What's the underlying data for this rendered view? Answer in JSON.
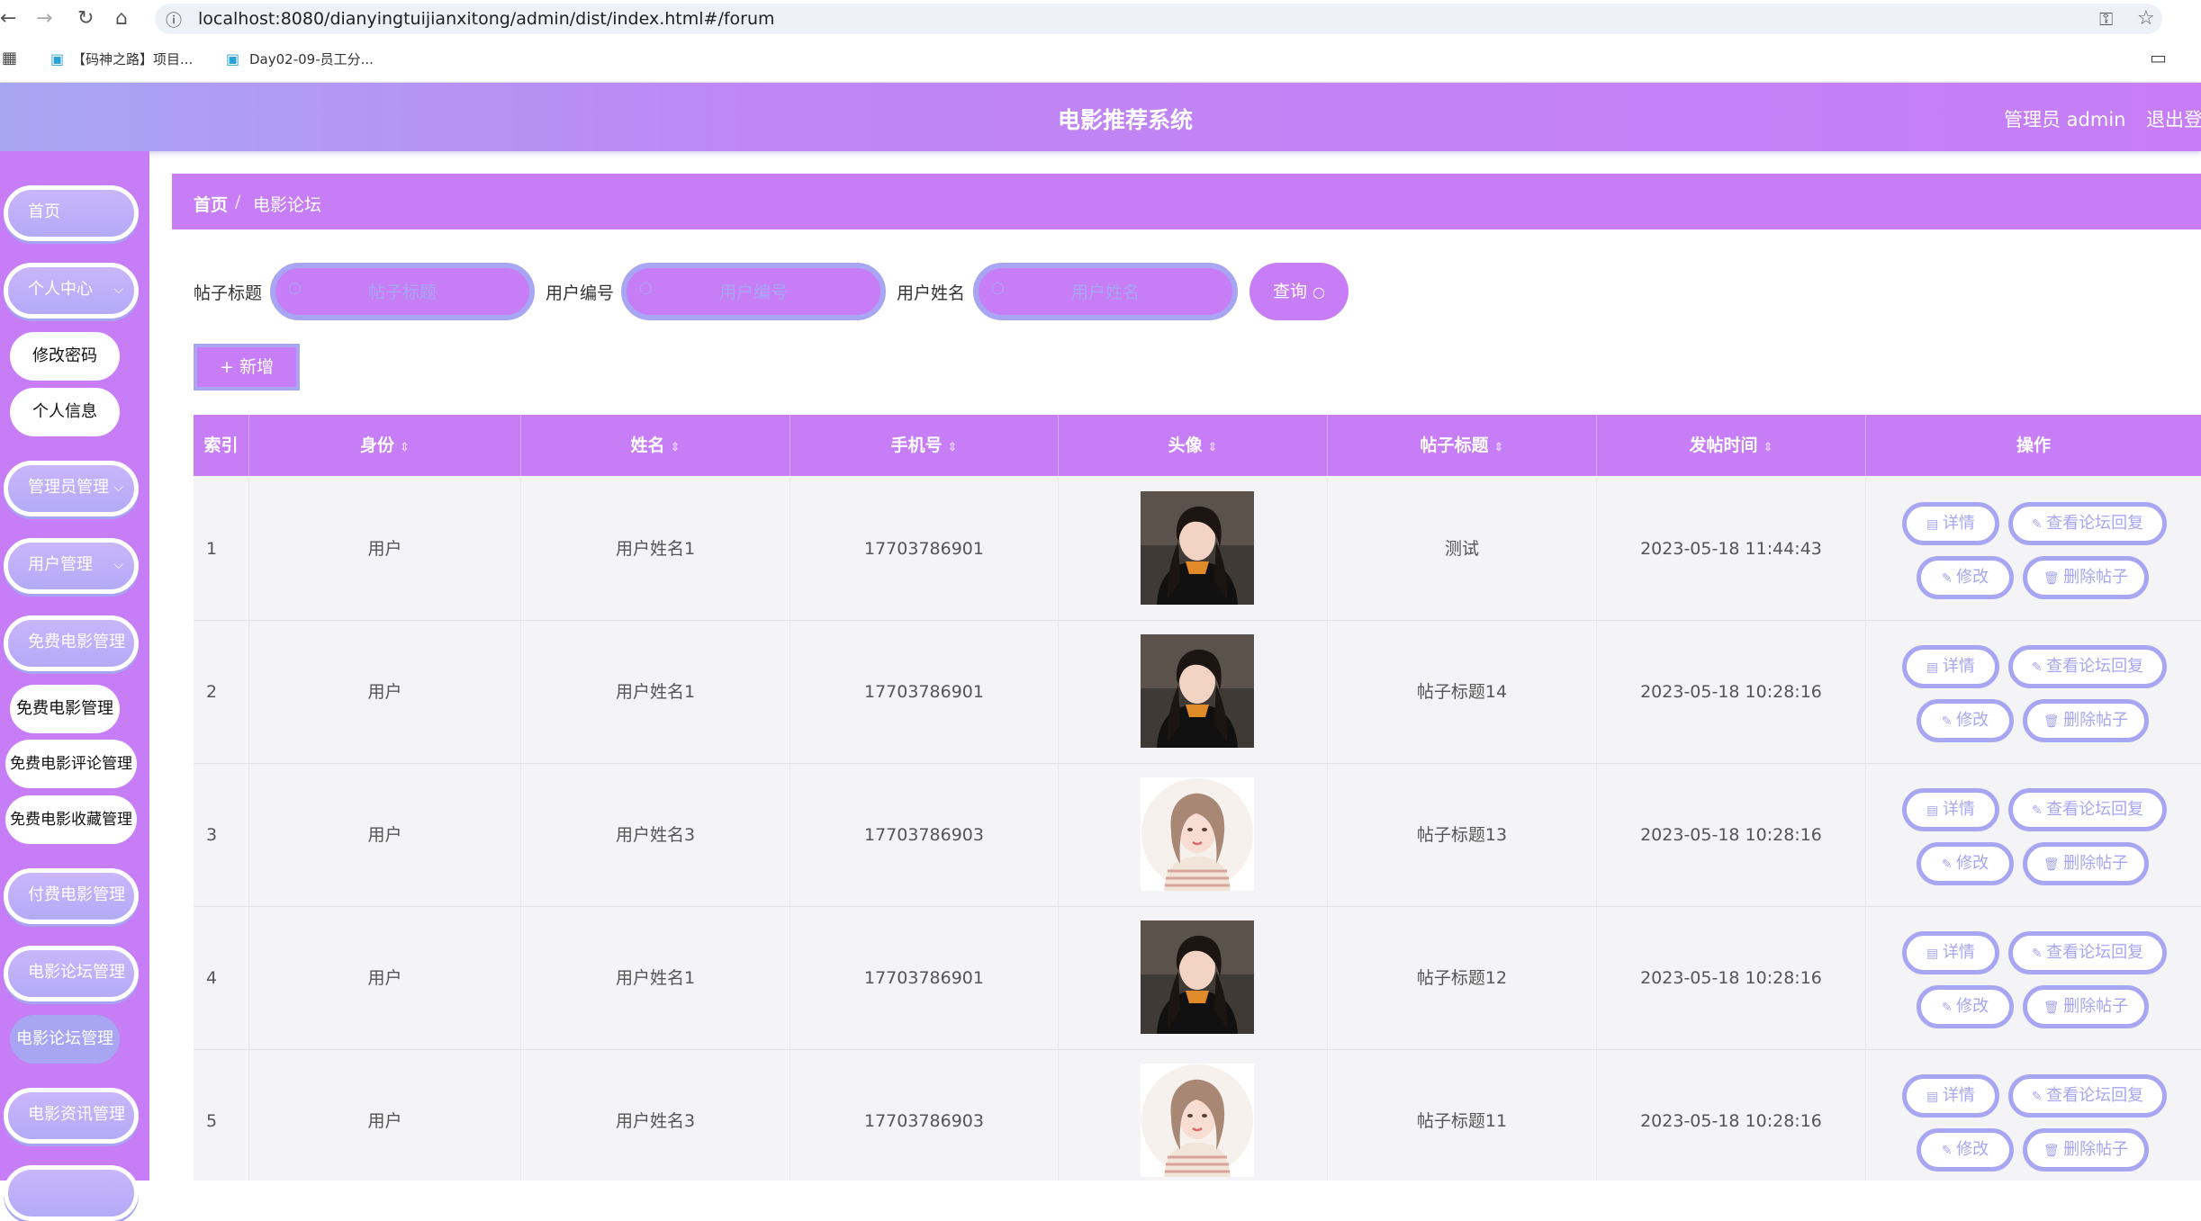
{
  "browser": {
    "url": "localhost:8080/dianyingtuijianxitong/admin/dist/index.html#/forum",
    "bookmarks": [
      "【码神之路】项目...",
      "Day02-09-员工分..."
    ]
  },
  "header": {
    "title": "电影推荐系统",
    "user": "管理员 admin",
    "logout": "退出登"
  },
  "sidebar": {
    "items": [
      {
        "label": "首页"
      },
      {
        "label": "个人中心"
      },
      {
        "label": "修改密码"
      },
      {
        "label": "个人信息"
      },
      {
        "label": "管理员管理"
      },
      {
        "label": "用户管理"
      },
      {
        "label": "免费电影管理"
      },
      {
        "label": "免费电影管理"
      },
      {
        "label": "免费电影评论管理"
      },
      {
        "label": "免费电影收藏管理"
      },
      {
        "label": "付费电影管理"
      },
      {
        "label": "电影论坛管理"
      },
      {
        "label": "电影论坛管理"
      },
      {
        "label": "电影资讯管理"
      }
    ]
  },
  "breadcrumb": {
    "home": "首页",
    "separator": "/",
    "current": "电影论坛"
  },
  "search": {
    "title_label": "帖子标题",
    "title_placeholder": "帖子标题",
    "user_no_label": "用户编号",
    "user_no_placeholder": "用户编号",
    "user_name_label": "用户姓名",
    "user_name_placeholder": "用户姓名",
    "query_button": "查询",
    "add_button": "新增"
  },
  "table": {
    "columns": [
      "索引",
      "身份",
      "姓名",
      "手机号",
      "头像",
      "帖子标题",
      "发帖时间",
      "操作"
    ],
    "rows": [
      {
        "index": "1",
        "identity": "用户",
        "name": "用户姓名1",
        "phone": "17703786901",
        "avatar": "avatar-a",
        "title": "测试",
        "time": "2023-05-18 11:44:43"
      },
      {
        "index": "2",
        "identity": "用户",
        "name": "用户姓名1",
        "phone": "17703786901",
        "avatar": "avatar-a",
        "title": "帖子标题14",
        "time": "2023-05-18 10:28:16"
      },
      {
        "index": "3",
        "identity": "用户",
        "name": "用户姓名3",
        "phone": "17703786903",
        "avatar": "avatar-b",
        "title": "帖子标题13",
        "time": "2023-05-18 10:28:16"
      },
      {
        "index": "4",
        "identity": "用户",
        "name": "用户姓名1",
        "phone": "17703786901",
        "avatar": "avatar-a",
        "title": "帖子标题12",
        "time": "2023-05-18 10:28:16"
      },
      {
        "index": "5",
        "identity": "用户",
        "name": "用户姓名3",
        "phone": "17703786903",
        "avatar": "avatar-b",
        "title": "帖子标题11",
        "time": "2023-05-18 10:28:16"
      }
    ],
    "actions": {
      "detail": "详情",
      "view_replies": "查看论坛回复",
      "edit": "修改",
      "delete": "删除帖子"
    }
  },
  "colors": {
    "primary": "#c77df6",
    "secondary": "#a8a6f3"
  }
}
